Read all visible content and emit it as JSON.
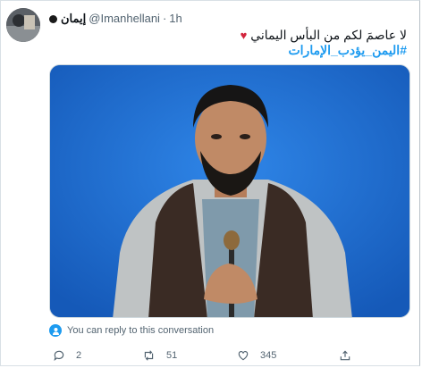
{
  "tweet": {
    "display_name": "إيمان",
    "handle": "@Imanhellani",
    "separator": "·",
    "time": "1h",
    "text_main": "لا عاصمَ لكم من البأس اليماني",
    "hashtag": "#اليمن_يؤدب_الإمارات"
  },
  "reply_notice": "You can reply to this conversation",
  "actions": {
    "replies": "2",
    "retweets": "51",
    "likes": "345"
  },
  "colors": {
    "accent": "#1d9bf0",
    "heart": "#d2243c",
    "media_background": "#1f6fd1"
  },
  "icons": [
    "avatar",
    "reply-permission-icon",
    "reply-icon",
    "retweet-icon",
    "like-icon",
    "share-icon",
    "heart-emoji"
  ]
}
